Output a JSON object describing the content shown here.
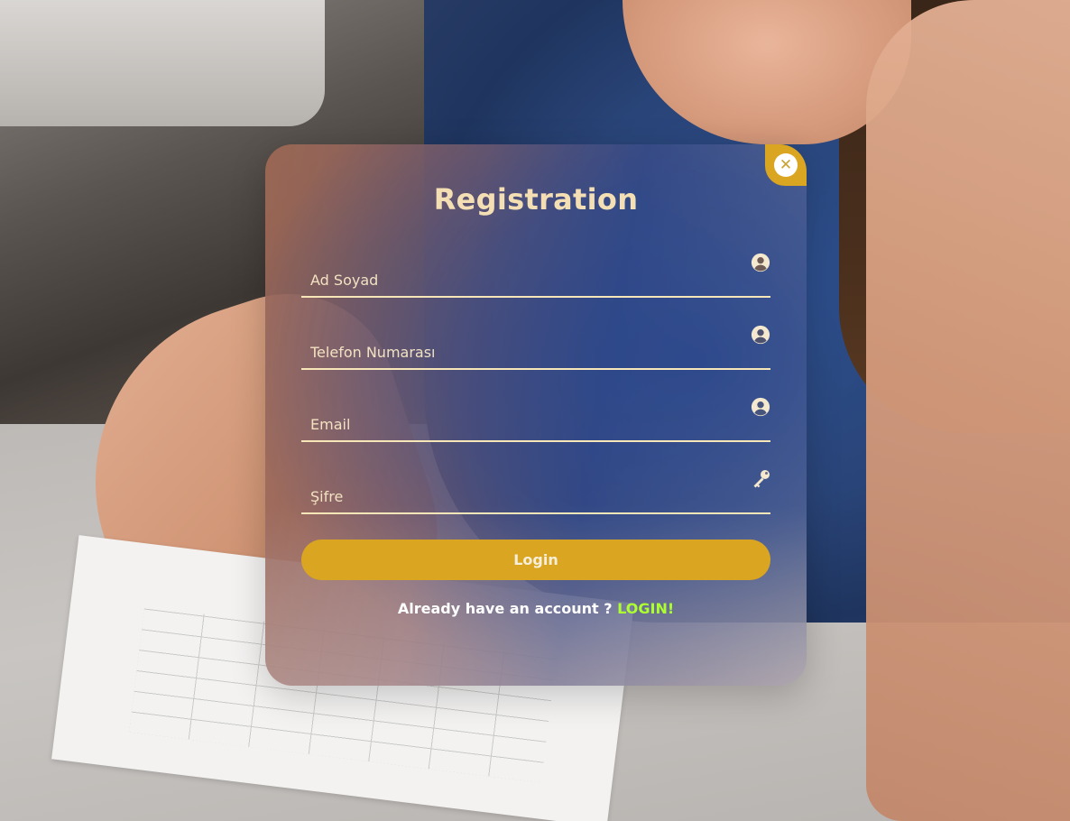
{
  "form": {
    "title": "Registration",
    "fields": [
      {
        "placeholder": "Ad Soyad",
        "value": "",
        "icon": "user-circle-icon"
      },
      {
        "placeholder": "Telefon Numarası",
        "value": "",
        "icon": "user-circle-icon"
      },
      {
        "placeholder": "Email",
        "value": "",
        "icon": "user-circle-icon"
      },
      {
        "placeholder": "Şifre",
        "value": "",
        "icon": "key-icon"
      }
    ],
    "submit_label": "Login",
    "switch_prompt": "Already have an account ?",
    "switch_link": "LOGIN!",
    "close_symbol": "✕"
  },
  "colors": {
    "accent": "#daa520",
    "title": "#f4dfb4",
    "link": "#adff2f",
    "underline": "#f6e6b8"
  }
}
